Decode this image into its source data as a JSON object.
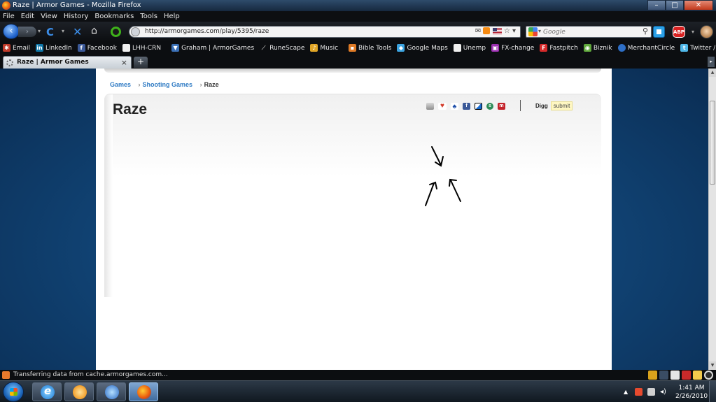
{
  "window": {
    "title": "Raze | Armor Games - Mozilla Firefox",
    "min": "–",
    "max": "□",
    "close": "✕"
  },
  "menu": [
    "File",
    "Edit",
    "View",
    "History",
    "Bookmarks",
    "Tools",
    "Help"
  ],
  "nav": {
    "back": "‹",
    "forward": "›",
    "reload": "C",
    "stop": "✕",
    "home": "⌂",
    "url": "http://armorgames.com/play/5395/raze",
    "search_placeholder": "Google",
    "search_icon": "⚲",
    "abp": "ABP"
  },
  "bookmarks": [
    {
      "label": "Email",
      "icon": "email-icon",
      "color": "#c13b2a"
    },
    {
      "label": "LinkedIn",
      "icon": "linkedin-icon",
      "color": "#0e76a8",
      "glyph": "in"
    },
    {
      "label": "Facebook",
      "icon": "facebook-icon",
      "color": "#3b5998",
      "glyph": "f"
    },
    {
      "label": "LHH-CRN",
      "icon": "page-icon",
      "color": "#f0f0f0"
    },
    {
      "label": "Graham | ArmorGames",
      "icon": "shield-icon",
      "color": "#3a6fb5"
    },
    {
      "label": "RuneScape",
      "icon": "sword-icon",
      "color": "#8a8a8a"
    },
    {
      "label": "Music",
      "icon": "music-icon",
      "color": "#e0a526"
    },
    {
      "label": "Bible Tools",
      "icon": "book-icon",
      "color": "#e07b26"
    },
    {
      "label": "Google Maps",
      "icon": "maps-icon",
      "color": "#3ba3e0"
    },
    {
      "label": "Unemp",
      "icon": "page-icon",
      "color": "#f0f0f0"
    },
    {
      "label": "FX-change",
      "icon": "fx-icon",
      "color": "#9b2fb0"
    },
    {
      "label": "Fastpitch",
      "icon": "f-icon",
      "color": "#d62a2a",
      "glyph": "F"
    },
    {
      "label": "Biznik",
      "icon": "biznik-icon",
      "color": "#5fa83b"
    },
    {
      "label": "MerchantCircle",
      "icon": "circle-icon",
      "color": "#2e6fc7"
    },
    {
      "label": "Twitter / Home",
      "icon": "twitter-icon",
      "color": "#4fb7e8"
    }
  ],
  "tab": {
    "label": "Raze | Armor Games",
    "close": "×",
    "new": "+"
  },
  "page": {
    "breadcrumb": [
      {
        "label": "Games",
        "link": true
      },
      {
        "label": "Shooting Games",
        "link": true
      },
      {
        "label": "Raze",
        "link": false
      }
    ],
    "breadcrumb_sep": "›",
    "title": "Raze",
    "share": [
      "email-icon",
      "favorite-heart-icon",
      "myspace-icon",
      "facebook-icon",
      "delicious-icon",
      "stumbleupon-icon",
      "mixx-icon"
    ],
    "digg_label": "Digg",
    "digg_submit": "submit"
  },
  "status": {
    "text": "Transferring data from cache.armorgames.com..."
  },
  "clock": {
    "time": "1:41 AM",
    "date": "2/26/2010"
  },
  "colors": {
    "link": "#2f7bc4",
    "background": "#0c3a66"
  }
}
